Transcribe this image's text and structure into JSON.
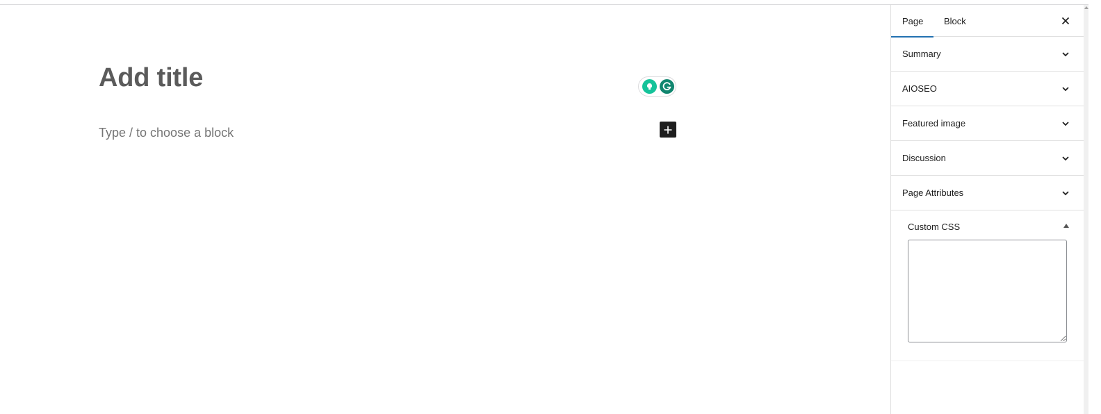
{
  "editor": {
    "title_placeholder": "Add title",
    "block_placeholder": "Type / to choose a block"
  },
  "icons": {
    "grammarly_bulb": "lightbulb-icon",
    "grammarly_logo": "grammarly-icon",
    "add_block": "plus-icon",
    "close": "close-icon",
    "chevron": "chevron-down-icon",
    "collapse": "triangle-up-icon"
  },
  "sidebar": {
    "tabs": [
      {
        "label": "Page",
        "active": true
      },
      {
        "label": "Block",
        "active": false
      }
    ],
    "panels": [
      {
        "label": "Summary"
      },
      {
        "label": "AIOSEO"
      },
      {
        "label": "Featured image"
      },
      {
        "label": "Discussion"
      },
      {
        "label": "Page Attributes"
      }
    ],
    "custom_css": {
      "label": "Custom CSS",
      "value": ""
    }
  },
  "colors": {
    "accent": "#2271b1",
    "grammarly_green": "#15c39a",
    "grammarly_dark": "#11866f",
    "button_dark": "#1e1e1e"
  }
}
